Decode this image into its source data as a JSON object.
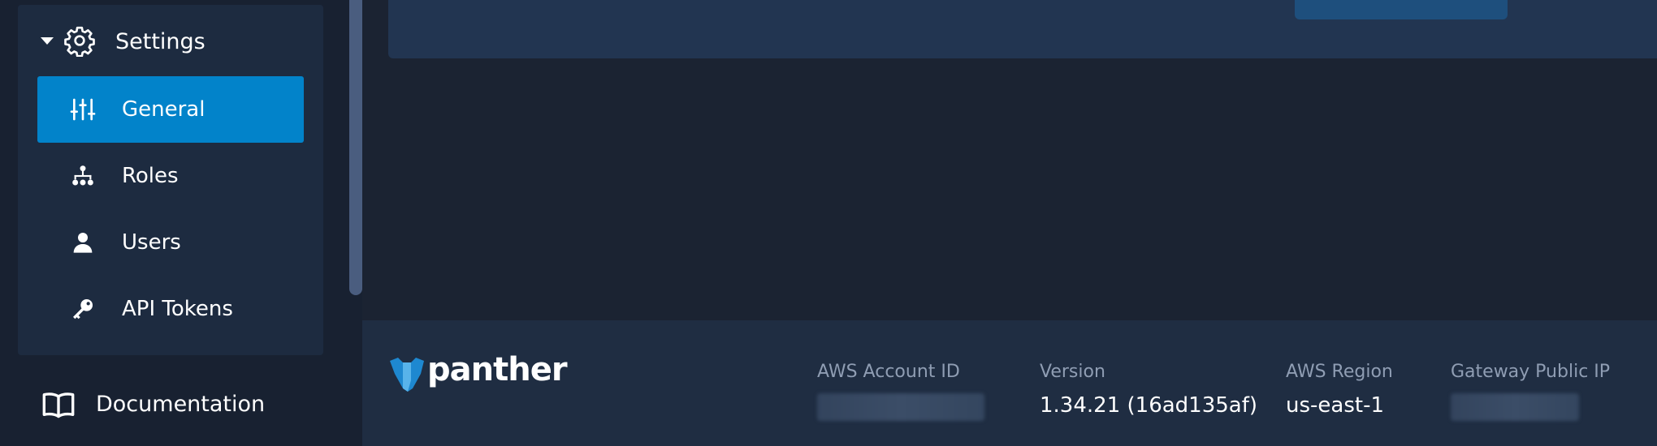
{
  "sidebar": {
    "section": {
      "label": "Settings",
      "icon": "gear-icon"
    },
    "items": [
      {
        "label": "General",
        "icon": "sliders-icon",
        "active": true
      },
      {
        "label": "Roles",
        "icon": "hierarchy-icon",
        "active": false
      },
      {
        "label": "Users",
        "icon": "user-icon",
        "active": false
      },
      {
        "label": "API Tokens",
        "icon": "key-icon",
        "active": false
      }
    ],
    "documentation": {
      "label": "Documentation",
      "icon": "book-icon"
    }
  },
  "footer": {
    "logo_text": "panther",
    "info": {
      "aws_account_id": {
        "label": "AWS Account ID",
        "value": ""
      },
      "version": {
        "label": "Version",
        "value": "1.34.21 (16ad135af)"
      },
      "aws_region": {
        "label": "AWS Region",
        "value": "us-east-1"
      },
      "gateway_ip": {
        "label": "Gateway Public IP",
        "value": ""
      }
    }
  },
  "colors": {
    "active_item": "#0283ca",
    "panel": "#1d2b40",
    "background": "#1b2332",
    "footer": "#1f2d42"
  }
}
